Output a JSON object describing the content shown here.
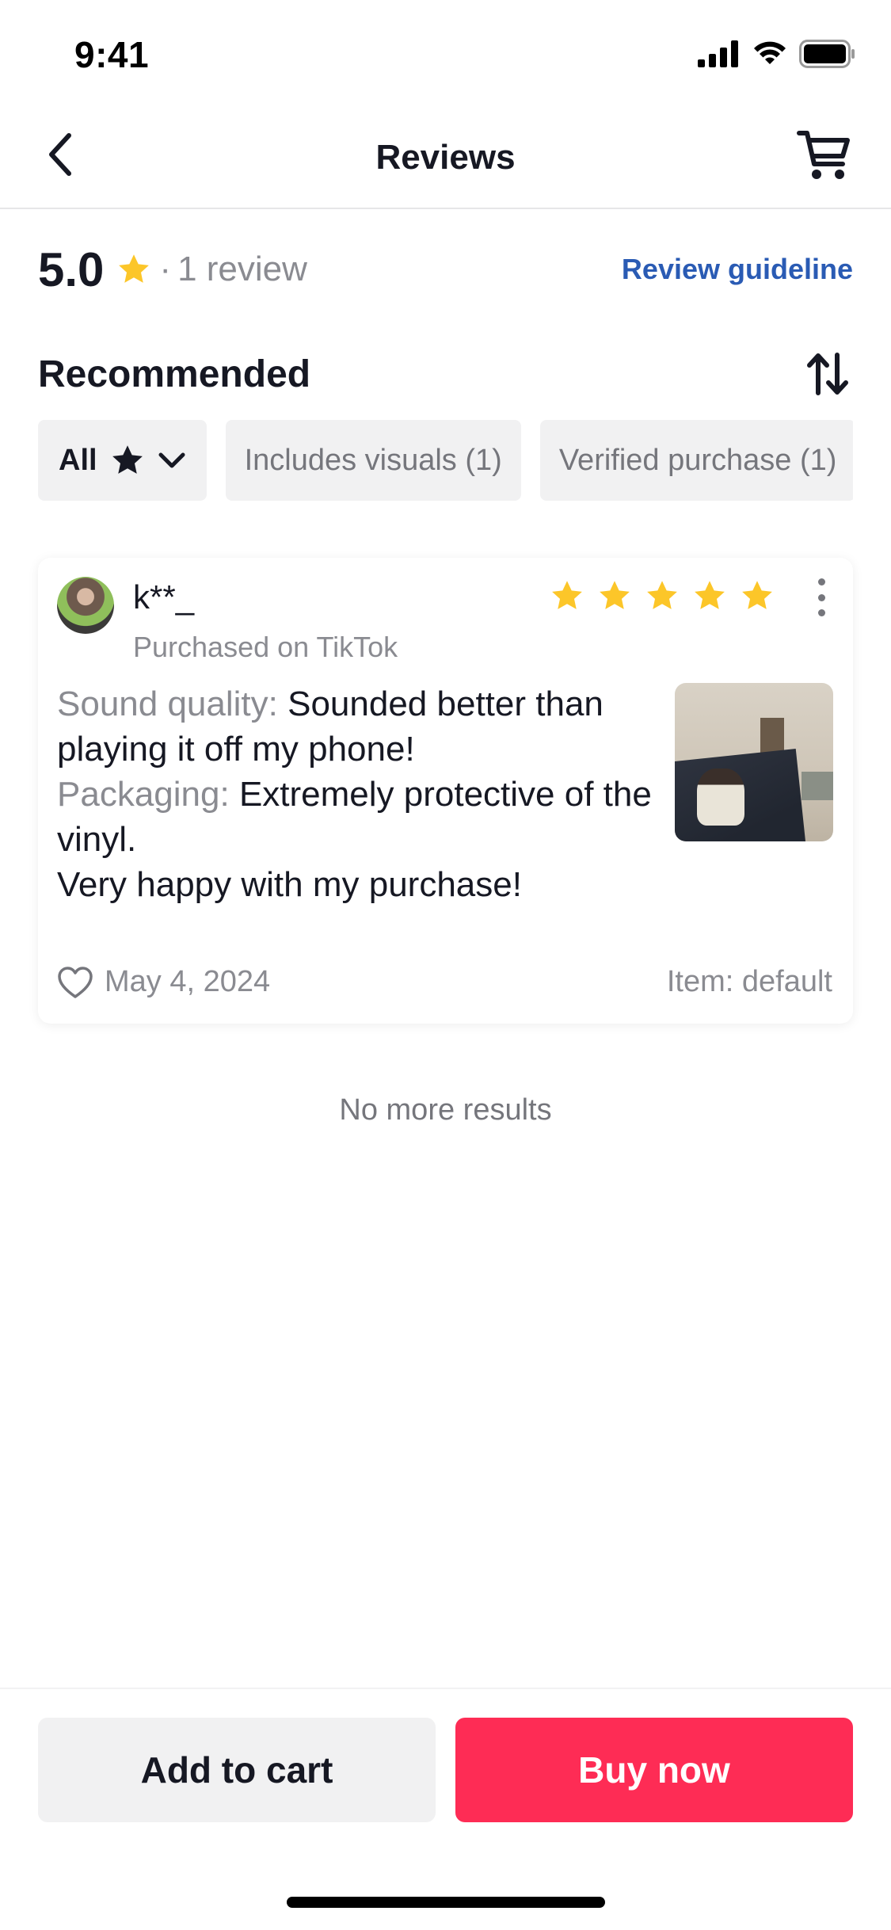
{
  "status_bar": {
    "time": "9:41"
  },
  "nav": {
    "title": "Reviews"
  },
  "summary": {
    "score": "5.0",
    "separator": "·",
    "review_count": "1 review",
    "guideline_link": "Review guideline"
  },
  "section": {
    "title": "Recommended"
  },
  "filters": [
    {
      "label": "All"
    },
    {
      "label": "Includes visuals (1)"
    },
    {
      "label": "Verified purchase (1)"
    }
  ],
  "review": {
    "name": "k**_",
    "source": "Purchased on TikTok",
    "rating": 5,
    "lines": [
      {
        "label": "Sound quality:",
        "text": "Sounded better than playing it off my phone!"
      },
      {
        "label": "Packaging:",
        "text": "Extremely protective of the vinyl."
      },
      {
        "label": "",
        "text": "Very happy with my purchase!"
      }
    ],
    "date": "May 4, 2024",
    "variant": "Item: default"
  },
  "footer_note": "No more results",
  "actions": {
    "add_to_cart": "Add to cart",
    "buy_now": "Buy now"
  },
  "colors": {
    "accent": "#fe2c55",
    "star": "#fcc629",
    "link": "#2a5bb4"
  },
  "icons": [
    "back-icon",
    "cart-icon",
    "star-icon",
    "sort-icon",
    "chevron-down-icon",
    "more-icon",
    "heart-icon",
    "signal-icon",
    "wifi-icon",
    "battery-icon"
  ]
}
